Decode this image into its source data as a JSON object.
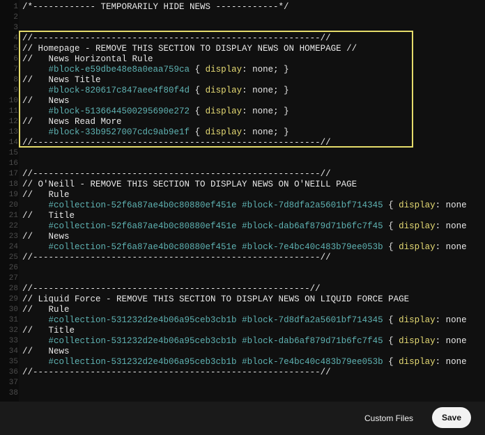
{
  "editor": {
    "lines": [
      {
        "n": "1",
        "tokens": [
          {
            "t": "/*------------ TEMPORARILY HIDE NEWS ------------*/",
            "c": ""
          }
        ]
      },
      {
        "n": "2",
        "tokens": []
      },
      {
        "n": "3",
        "tokens": []
      },
      {
        "n": "4",
        "tokens": [
          {
            "t": "//-------------------------------------------------------//",
            "c": ""
          }
        ]
      },
      {
        "n": "5",
        "tokens": [
          {
            "t": "// Homepage - REMOVE THIS SECTION TO DISPLAY NEWS ON HOMEPAGE //",
            "c": ""
          }
        ]
      },
      {
        "n": "6",
        "tokens": [
          {
            "t": "//   News Horizontal Rule",
            "c": ""
          }
        ]
      },
      {
        "n": "7",
        "tokens": [
          {
            "t": "     ",
            "c": ""
          },
          {
            "t": "#block-e59dbe48e8a0eaa759ca",
            "c": "sel"
          },
          {
            "t": " { ",
            "c": ""
          },
          {
            "t": "display",
            "c": "kw"
          },
          {
            "t": ": none; }",
            "c": ""
          }
        ]
      },
      {
        "n": "8",
        "tokens": [
          {
            "t": "//   News Title",
            "c": ""
          }
        ]
      },
      {
        "n": "9",
        "tokens": [
          {
            "t": "     ",
            "c": ""
          },
          {
            "t": "#block-820617c847aee4f80f4d",
            "c": "sel"
          },
          {
            "t": " { ",
            "c": ""
          },
          {
            "t": "display",
            "c": "kw"
          },
          {
            "t": ": none; }",
            "c": ""
          }
        ]
      },
      {
        "n": "10",
        "tokens": [
          {
            "t": "//   News",
            "c": ""
          }
        ]
      },
      {
        "n": "11",
        "tokens": [
          {
            "t": "     ",
            "c": ""
          },
          {
            "t": "#block-5136644500295690e272",
            "c": "sel"
          },
          {
            "t": " { ",
            "c": ""
          },
          {
            "t": "display",
            "c": "kw"
          },
          {
            "t": ": none; }",
            "c": ""
          }
        ]
      },
      {
        "n": "12",
        "tokens": [
          {
            "t": "//   News Read More",
            "c": ""
          }
        ]
      },
      {
        "n": "13",
        "tokens": [
          {
            "t": "     ",
            "c": ""
          },
          {
            "t": "#block-33b9527007cdc9ab9e1f",
            "c": "sel"
          },
          {
            "t": " { ",
            "c": ""
          },
          {
            "t": "display",
            "c": "kw"
          },
          {
            "t": ": none; }",
            "c": ""
          }
        ]
      },
      {
        "n": "14",
        "tokens": [
          {
            "t": "//-------------------------------------------------------//",
            "c": ""
          }
        ]
      },
      {
        "n": "15",
        "tokens": []
      },
      {
        "n": "16",
        "tokens": []
      },
      {
        "n": "17",
        "tokens": [
          {
            "t": "//-------------------------------------------------------//",
            "c": ""
          }
        ]
      },
      {
        "n": "18",
        "tokens": [
          {
            "t": "// O'Neill - REMOVE THIS SECTION TO DISPLAY NEWS ON O'NEILL PAGE",
            "c": ""
          }
        ]
      },
      {
        "n": "19",
        "tokens": [
          {
            "t": "//   Rule",
            "c": ""
          }
        ]
      },
      {
        "n": "20",
        "tokens": [
          {
            "t": "     ",
            "c": ""
          },
          {
            "t": "#collection-52f6a87ae4b0c80880ef451e",
            "c": "sel"
          },
          {
            "t": " ",
            "c": ""
          },
          {
            "t": "#block-7d8dfa2a5601bf714345",
            "c": "sel"
          },
          {
            "t": " { ",
            "c": ""
          },
          {
            "t": "display",
            "c": "kw"
          },
          {
            "t": ": none",
            "c": ""
          }
        ]
      },
      {
        "n": "21",
        "tokens": [
          {
            "t": "//   Title",
            "c": ""
          }
        ]
      },
      {
        "n": "22",
        "tokens": [
          {
            "t": "     ",
            "c": ""
          },
          {
            "t": "#collection-52f6a87ae4b0c80880ef451e",
            "c": "sel"
          },
          {
            "t": " ",
            "c": ""
          },
          {
            "t": "#block-dab6af879d71b6fc7f45",
            "c": "sel"
          },
          {
            "t": " { ",
            "c": ""
          },
          {
            "t": "display",
            "c": "kw"
          },
          {
            "t": ": none",
            "c": ""
          }
        ]
      },
      {
        "n": "23",
        "tokens": [
          {
            "t": "//   News",
            "c": ""
          }
        ]
      },
      {
        "n": "24",
        "tokens": [
          {
            "t": "     ",
            "c": ""
          },
          {
            "t": "#collection-52f6a87ae4b0c80880ef451e",
            "c": "sel"
          },
          {
            "t": " ",
            "c": ""
          },
          {
            "t": "#block-7e4bc40c483b79ee053b",
            "c": "sel"
          },
          {
            "t": " { ",
            "c": ""
          },
          {
            "t": "display",
            "c": "kw"
          },
          {
            "t": ": none",
            "c": ""
          }
        ]
      },
      {
        "n": "25",
        "tokens": [
          {
            "t": "//-------------------------------------------------------//",
            "c": ""
          }
        ]
      },
      {
        "n": "26",
        "tokens": []
      },
      {
        "n": "27",
        "tokens": []
      },
      {
        "n": "28",
        "tokens": [
          {
            "t": "//-----------------------------------------------------//",
            "c": ""
          }
        ]
      },
      {
        "n": "29",
        "tokens": [
          {
            "t": "// Liquid Force - REMOVE THIS SECTION TO DISPLAY NEWS ON LIQUID FORCE PAGE",
            "c": ""
          }
        ]
      },
      {
        "n": "30",
        "tokens": [
          {
            "t": "//   Rule",
            "c": ""
          }
        ]
      },
      {
        "n": "31",
        "tokens": [
          {
            "t": "     ",
            "c": ""
          },
          {
            "t": "#collection-531232d2e4b06a95ceb3cb1b",
            "c": "sel"
          },
          {
            "t": " ",
            "c": ""
          },
          {
            "t": "#block-7d8dfa2a5601bf714345",
            "c": "sel"
          },
          {
            "t": " { ",
            "c": ""
          },
          {
            "t": "display",
            "c": "kw"
          },
          {
            "t": ": none",
            "c": ""
          }
        ]
      },
      {
        "n": "32",
        "tokens": [
          {
            "t": "//   Title",
            "c": ""
          }
        ]
      },
      {
        "n": "33",
        "tokens": [
          {
            "t": "     ",
            "c": ""
          },
          {
            "t": "#collection-531232d2e4b06a95ceb3cb1b",
            "c": "sel"
          },
          {
            "t": " ",
            "c": ""
          },
          {
            "t": "#block-dab6af879d71b6fc7f45",
            "c": "sel"
          },
          {
            "t": " { ",
            "c": ""
          },
          {
            "t": "display",
            "c": "kw"
          },
          {
            "t": ": none",
            "c": ""
          }
        ]
      },
      {
        "n": "34",
        "tokens": [
          {
            "t": "//   News",
            "c": ""
          }
        ]
      },
      {
        "n": "35",
        "tokens": [
          {
            "t": "     ",
            "c": ""
          },
          {
            "t": "#collection-531232d2e4b06a95ceb3cb1b",
            "c": "sel"
          },
          {
            "t": " ",
            "c": ""
          },
          {
            "t": "#block-7e4bc40c483b79ee053b",
            "c": "sel"
          },
          {
            "t": " { ",
            "c": ""
          },
          {
            "t": "display",
            "c": "kw"
          },
          {
            "t": ": none",
            "c": ""
          }
        ]
      },
      {
        "n": "36",
        "tokens": [
          {
            "t": "//-------------------------------------------------------//",
            "c": ""
          }
        ]
      },
      {
        "n": "37",
        "tokens": []
      },
      {
        "n": "38",
        "tokens": []
      }
    ]
  },
  "footer": {
    "custom_files_label": "Custom Files",
    "save_label": "Save"
  },
  "colors": {
    "background": "#101010",
    "selector": "#5fb3b3",
    "keyword": "#e6db74",
    "highlight_border": "#e5dc6b"
  }
}
